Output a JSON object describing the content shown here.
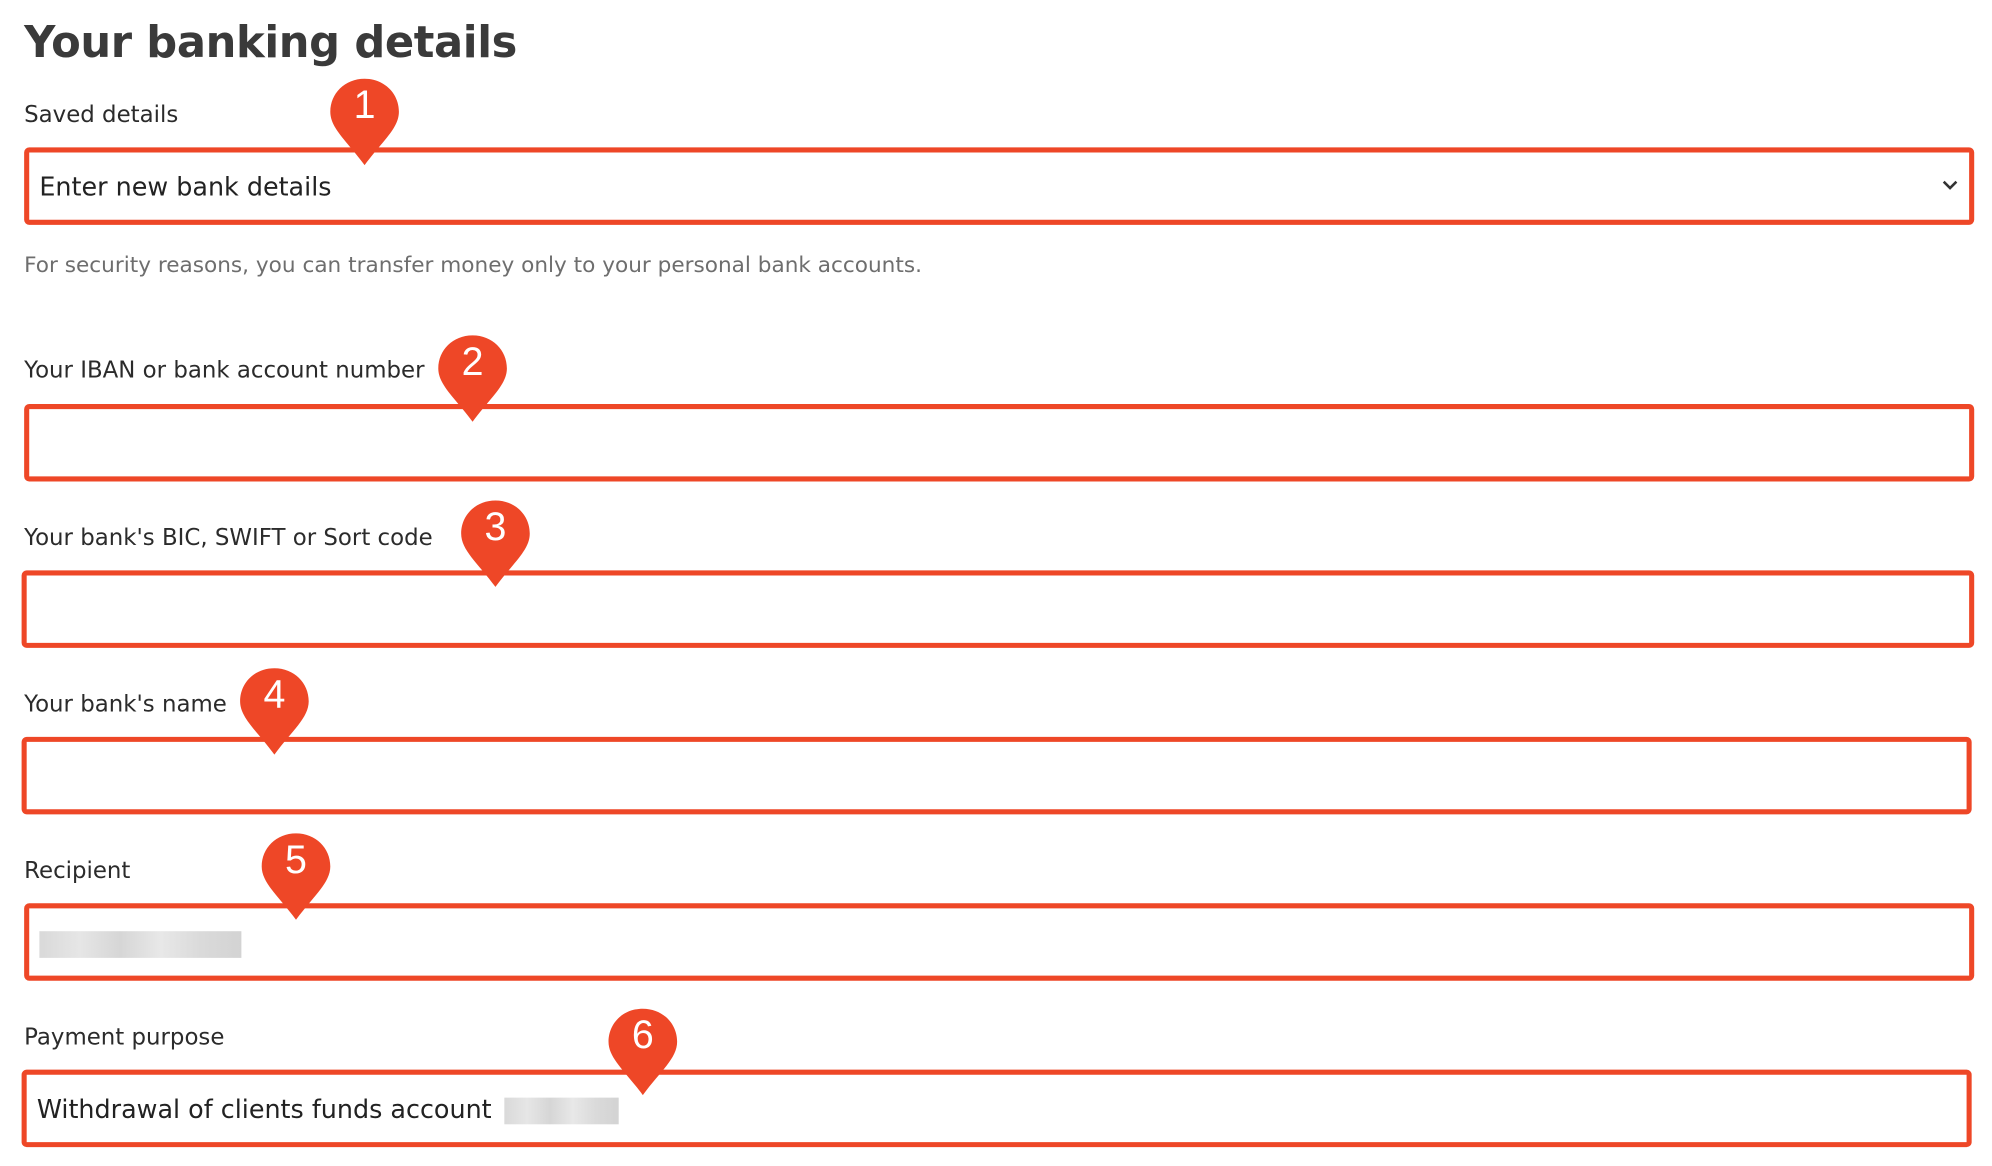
{
  "page": {
    "title": "Your banking details"
  },
  "accent_color": "#ee4727",
  "saved_details": {
    "label": "Saved details",
    "selected": "Enter new bank details",
    "hint": "For security reasons, you can transfer money only to your personal bank accounts.",
    "icon": "chevron-down-icon"
  },
  "fields": {
    "iban": {
      "label": "Your IBAN or bank account number",
      "value": ""
    },
    "bic": {
      "label": "Your bank's BIC, SWIFT or Sort code",
      "value": ""
    },
    "bank_name": {
      "label": "Your bank's name",
      "value": ""
    },
    "recipient": {
      "label": "Recipient",
      "value": ""
    },
    "purpose": {
      "label": "Payment purpose",
      "value": "Withdrawal of clients funds account"
    }
  },
  "markers": [
    "1",
    "2",
    "3",
    "4",
    "5",
    "6"
  ]
}
